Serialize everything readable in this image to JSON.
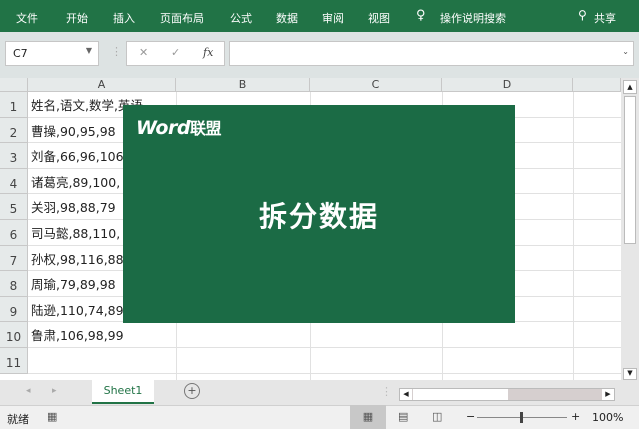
{
  "ribbon": {
    "tabs": [
      "文件",
      "开始",
      "插入",
      "页面布局",
      "公式",
      "数据",
      "审阅",
      "视图"
    ],
    "tell_me": "操作说明搜索",
    "share": "共享"
  },
  "formula_bar": {
    "name_box": "C7",
    "cancel": "✕",
    "enter": "✓",
    "fx": "fx",
    "formula": ""
  },
  "columns": [
    "A",
    "B",
    "C",
    "D"
  ],
  "rows": [
    "1",
    "2",
    "3",
    "4",
    "5",
    "6",
    "7",
    "8",
    "9",
    "10",
    "11"
  ],
  "cells_a": [
    "姓名,语文,数学,英语",
    "曹操,90,95,98",
    "刘备,66,96,106",
    "诸葛亮,89,100,",
    "关羽,98,88,79",
    "司马懿,88,110,",
    "孙权,98,116,88",
    "周瑜,79,89,98",
    "陆逊,110,74,89",
    "鲁肃,106,98,99",
    ""
  ],
  "overlay": {
    "logo_word": "Word",
    "logo_cn": "联盟",
    "headline": "拆分数据"
  },
  "sheet_tabs": [
    "Sheet1"
  ],
  "status": {
    "ready": "就绪",
    "zoom": "100%"
  },
  "colors": {
    "brand": "#217346",
    "overlay": "#1b6b45"
  }
}
